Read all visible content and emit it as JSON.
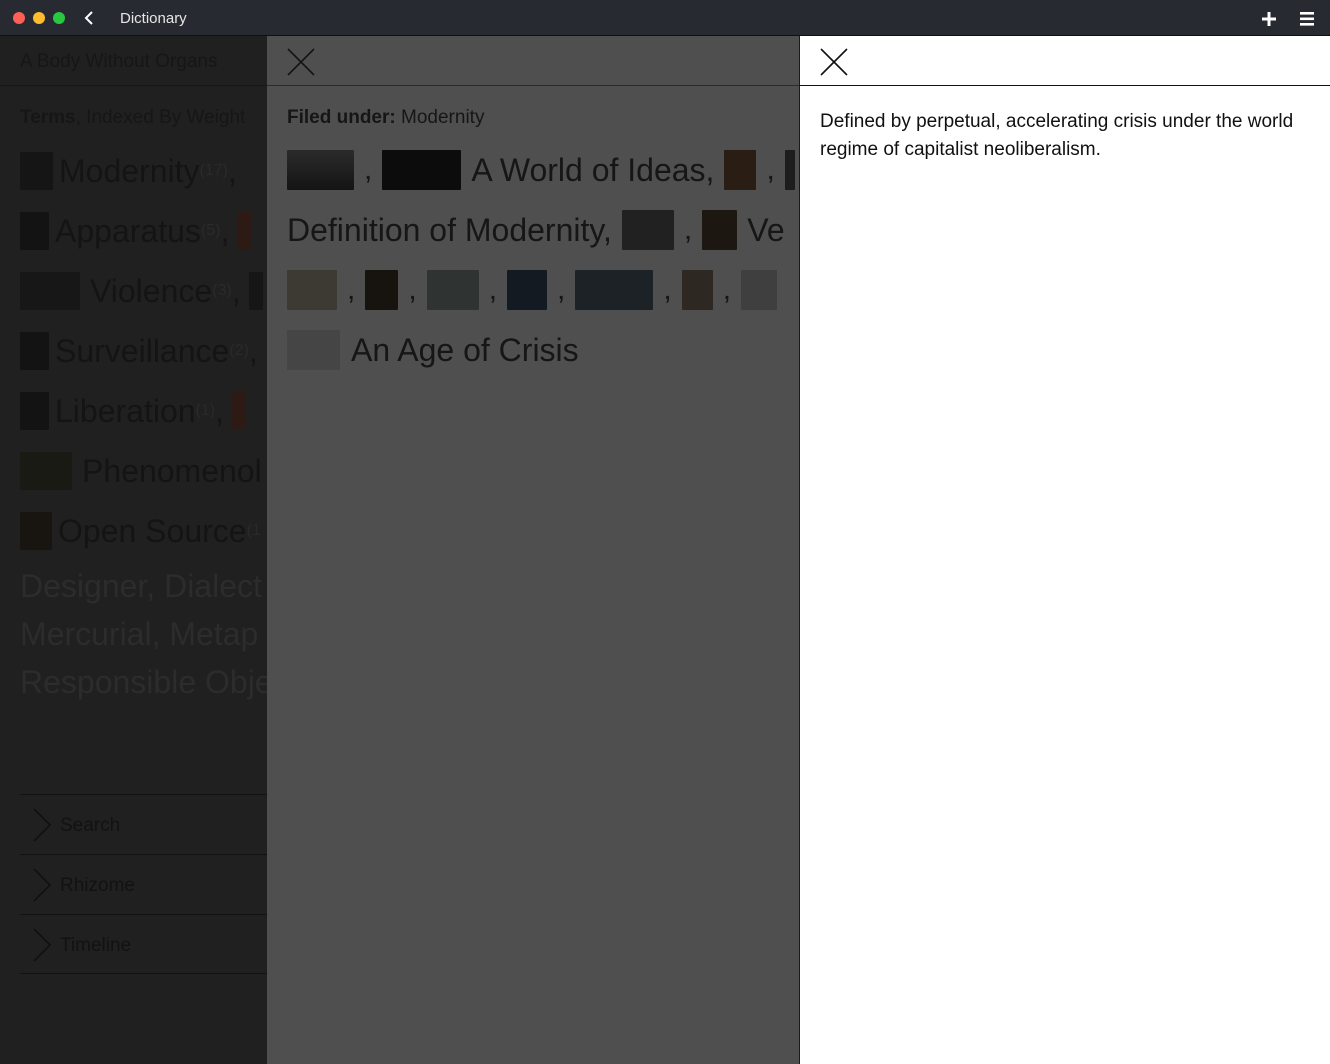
{
  "window": {
    "title": "Dictionary"
  },
  "left": {
    "header": "A Body Without Organs",
    "subtitle_bold": "Terms",
    "subtitle_rest": ", Indexed By Weight",
    "terms": [
      {
        "name": "Modernity",
        "count": "(17)"
      },
      {
        "name": "Apparatus",
        "count": "(5)"
      },
      {
        "name": "Violence",
        "count": "(3)"
      },
      {
        "name": "Surveillance",
        "count": "(2)"
      },
      {
        "name": "Liberation",
        "count": "(1)"
      },
      {
        "name": "Phenomenol",
        "count": ""
      },
      {
        "name": "Open Source",
        "count": "(1"
      }
    ],
    "more_lines": [
      "Designer,  Dialect",
      "Mercurial,  Metap",
      "Responsible Obje"
    ],
    "accordion": [
      "Search",
      "Rhizome",
      "Timeline"
    ]
  },
  "middle": {
    "filed_label": "Filed under:",
    "filed_value": "Modernity",
    "titles": [
      "A World of Ideas,",
      "Definition of Modernity,",
      "Ve",
      "An Age of Crisis"
    ]
  },
  "right": {
    "definition": "Defined by perpetual, accelerating crisis under the world regime of capitalist neoliberalism."
  },
  "colors": {
    "titlebar": "#272a31",
    "dim_left": "#202020",
    "dim_middle": "#4f4f4f",
    "panel": "#ffffff"
  }
}
